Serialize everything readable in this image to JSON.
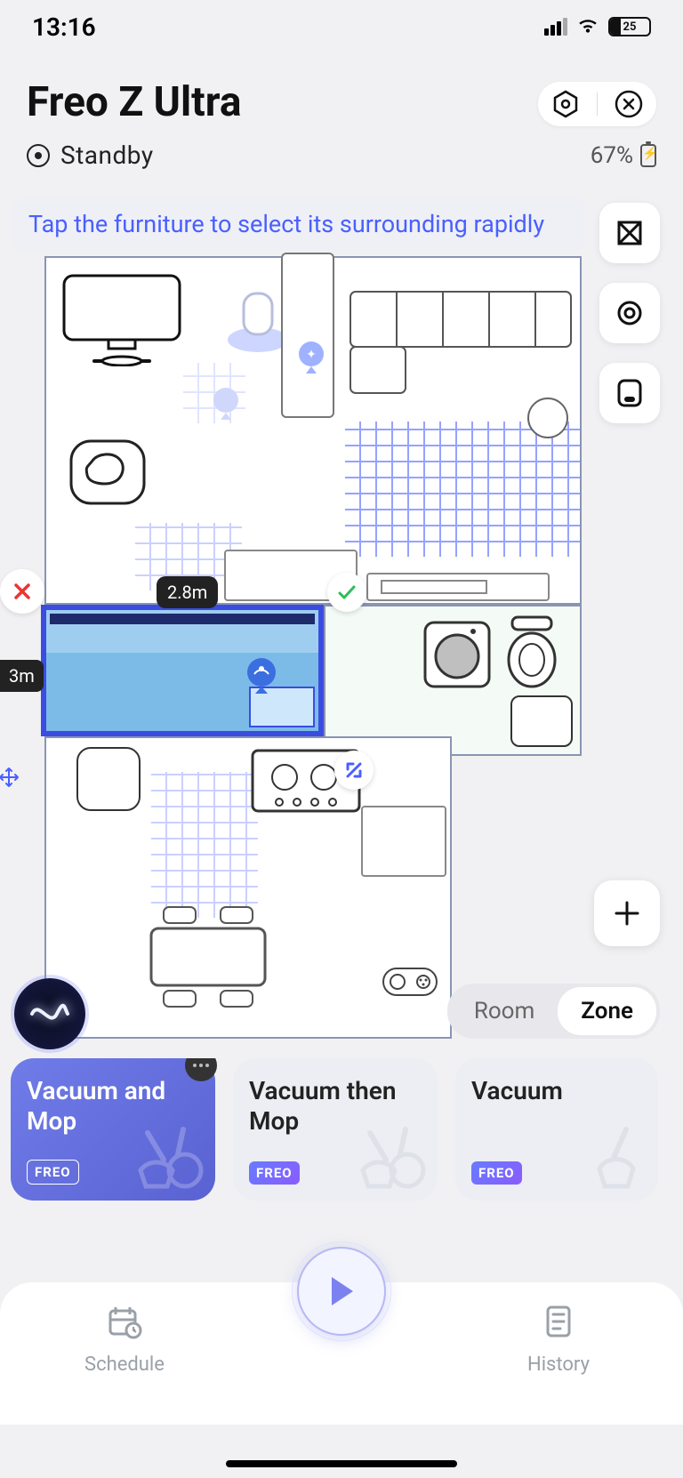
{
  "status_bar": {
    "time": "13:16",
    "battery_percent": "25"
  },
  "header": {
    "device_name": "Freo Z Ultra",
    "state_label": "Standby",
    "battery_text": "67%"
  },
  "tip": {
    "text": "Tap the furniture to select its surrounding rapidly"
  },
  "map": {
    "selected_room_width": "2.8m",
    "selected_room_height": "3m"
  },
  "view_toggle": {
    "room": "Room",
    "zone": "Zone"
  },
  "modes": {
    "items": [
      {
        "title": "Vacuum and Mop",
        "chip": "FREO"
      },
      {
        "title": "Vacuum then Mop",
        "chip": "FREO"
      },
      {
        "title": "Vacuum",
        "chip": "FREO"
      }
    ]
  },
  "bottom": {
    "schedule": "Schedule",
    "history": "History"
  }
}
